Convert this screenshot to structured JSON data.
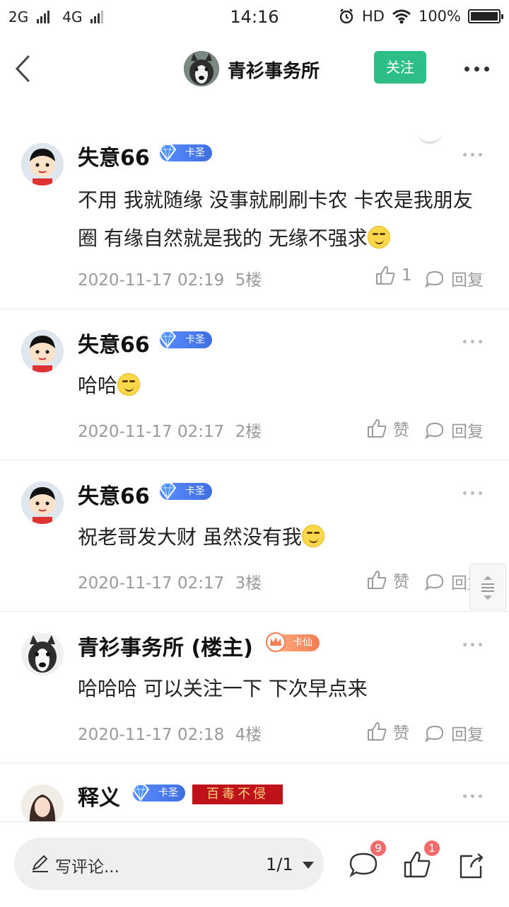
{
  "status_bar": {
    "network_1": "2G",
    "network_2": "4G",
    "time": "14:16",
    "hd": "HD",
    "battery": "100%"
  },
  "header": {
    "title": "青衫事务所",
    "follow_label": "关注"
  },
  "comments": [
    {
      "user": "失意66",
      "badge": "卡圣",
      "text": "不用 我就随缘 没事就刷刷卡农 卡农是我朋友圈 有缘自然就是我的 无缘不强求",
      "time": "2020-11-17 02:19",
      "floor": "5楼",
      "likes": "1",
      "reply_label": "回复"
    },
    {
      "user": "失意66",
      "badge": "卡圣",
      "text": "哈哈",
      "time": "2020-11-17 02:17",
      "floor": "2楼",
      "like_label": "赞",
      "reply_label": "回复"
    },
    {
      "user": "失意66",
      "badge": "卡圣",
      "text": "祝老哥发大财 虽然没有我",
      "time": "2020-11-17 02:17",
      "floor": "3楼",
      "like_label": "赞",
      "reply_label": "回复"
    },
    {
      "user": "青衫事务所 (楼主)",
      "badge": "卡仙",
      "text": "哈哈哈 可以关注一下 下次早点来",
      "time": "2020-11-17 02:18",
      "floor": "4楼",
      "like_label": "赞",
      "reply_label": "回复"
    },
    {
      "user": "释义",
      "badge": "卡圣",
      "title_tag": "百毒不侵"
    }
  ],
  "bottom_bar": {
    "input_placeholder": "写评论...",
    "page": "1/1",
    "comment_count": "9",
    "like_count": "1"
  },
  "colors": {
    "accent_green": "#2ebf88",
    "badge_blue": "#3f6fe0",
    "badge_orange": "#f37e52",
    "count_red": "#f26b6b"
  },
  "icons": [
    "back-icon",
    "more-icon",
    "gem-icon",
    "crown-icon",
    "thumb-up-icon",
    "reply-bubble-icon",
    "pen-icon",
    "comment-icon",
    "share-icon",
    "scroll-icon"
  ]
}
